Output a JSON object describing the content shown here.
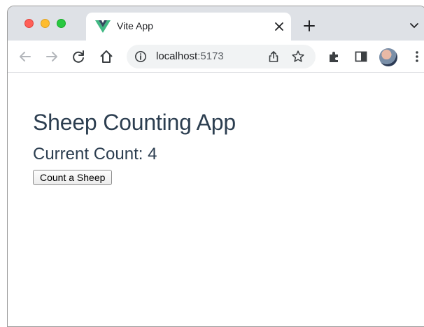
{
  "browser": {
    "tab": {
      "title": "Vite App",
      "favicon": "vue-logo-icon"
    },
    "address_bar": {
      "host": "localhost",
      "port": ":5173"
    },
    "colors": {
      "tabstrip": "#dee1e6",
      "close_red": "#ff5f57",
      "minimize_yellow": "#febc2e",
      "zoom_green": "#28c840"
    }
  },
  "app": {
    "title": "Sheep Counting App",
    "count_prefix": "Current Count: ",
    "count": "4",
    "button_label": "Count a Sheep",
    "text_color": "#2c3e50"
  }
}
